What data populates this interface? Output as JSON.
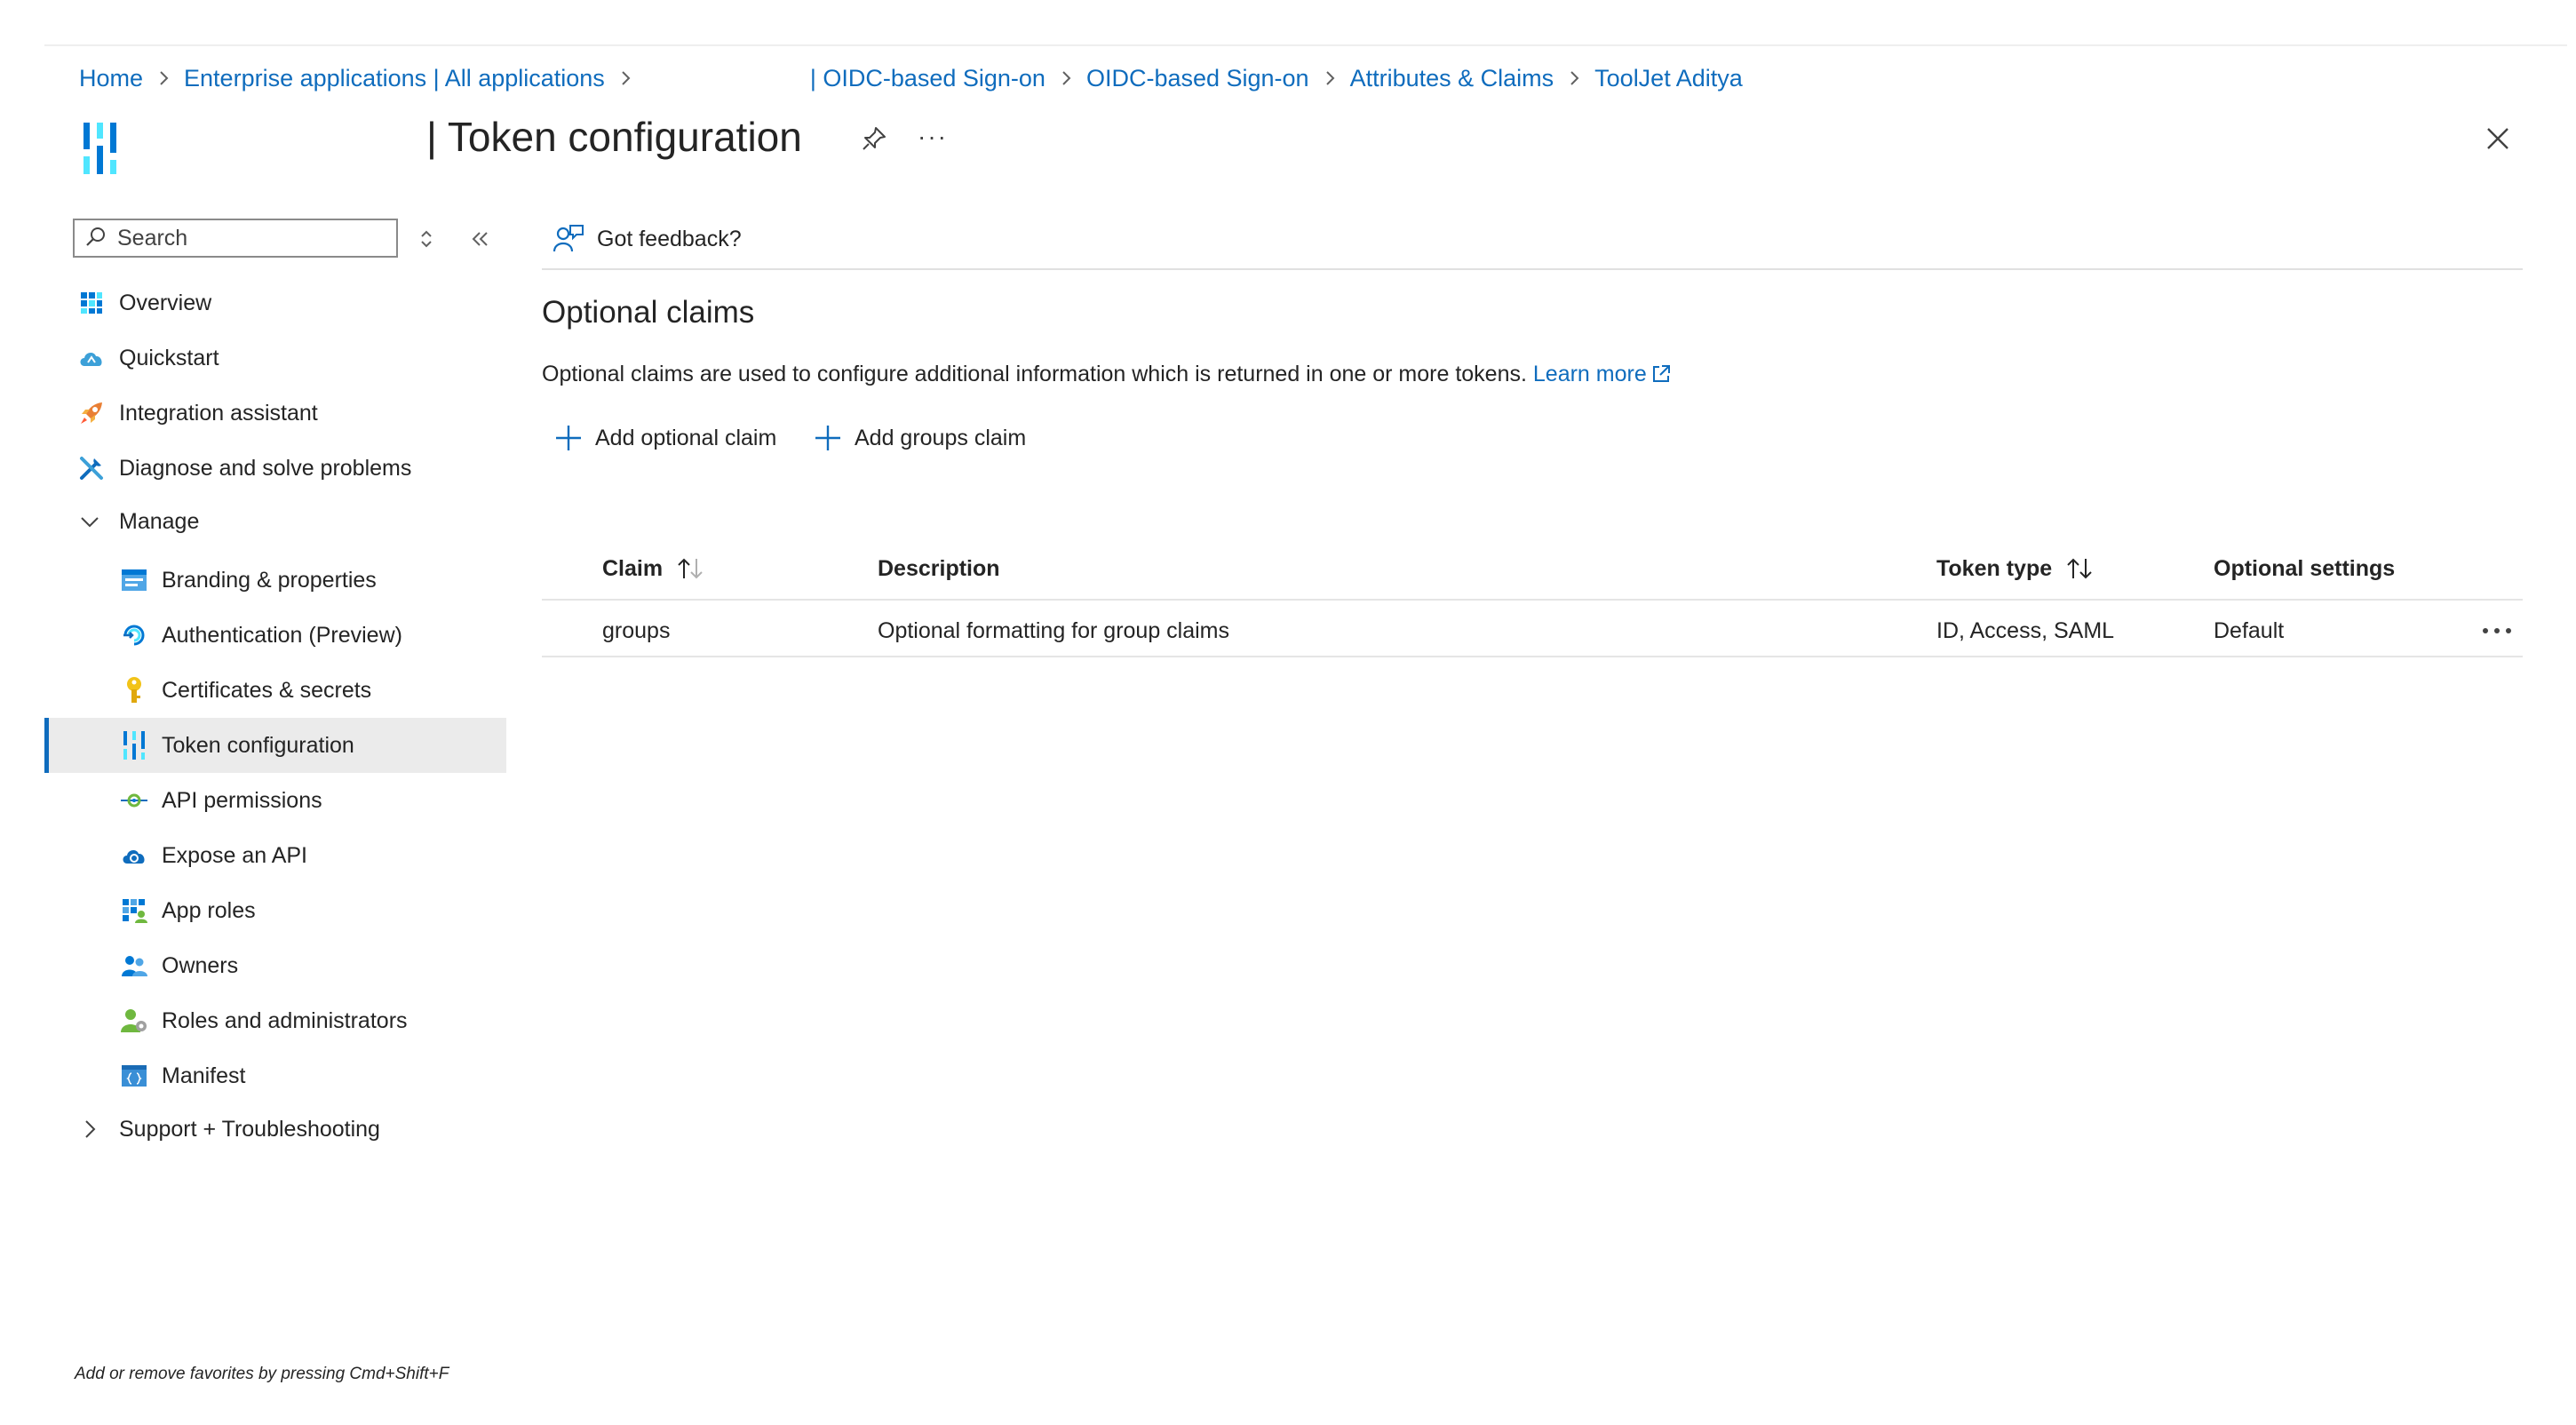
{
  "breadcrumb": {
    "items": [
      "Home",
      "Enterprise applications | All applications",
      "| OIDC-based Sign-on",
      "OIDC-based Sign-on",
      "Attributes & Claims",
      "ToolJet Aditya"
    ]
  },
  "header": {
    "title": "| Token configuration",
    "more_label": "···"
  },
  "sidebar": {
    "search_placeholder": "Search",
    "items": [
      {
        "label": "Overview",
        "icon": "overview-grid-icon"
      },
      {
        "label": "Quickstart",
        "icon": "cloud-icon"
      },
      {
        "label": "Integration assistant",
        "icon": "rocket-icon"
      },
      {
        "label": "Diagnose and solve problems",
        "icon": "wrench-icon"
      }
    ],
    "manage": {
      "label": "Manage",
      "items": [
        {
          "label": "Branding & properties",
          "icon": "branding-icon"
        },
        {
          "label": "Authentication (Preview)",
          "icon": "authentication-icon"
        },
        {
          "label": "Certificates & secrets",
          "icon": "key-icon"
        },
        {
          "label": "Token configuration",
          "icon": "token-bars-icon",
          "active": true
        },
        {
          "label": "API permissions",
          "icon": "api-permissions-icon"
        },
        {
          "label": "Expose an API",
          "icon": "cloud-api-icon"
        },
        {
          "label": "App roles",
          "icon": "app-roles-icon"
        },
        {
          "label": "Owners",
          "icon": "owners-icon"
        },
        {
          "label": "Roles and administrators",
          "icon": "roles-admin-icon"
        },
        {
          "label": "Manifest",
          "icon": "manifest-icon"
        }
      ]
    },
    "support": {
      "label": "Support + Troubleshooting"
    },
    "favorites_hint": "Add or remove favorites by pressing Cmd+Shift+F"
  },
  "main": {
    "feedback_label": "Got feedback?",
    "section_title": "Optional claims",
    "description": "Optional claims are used to configure additional information which is returned in one or more tokens.",
    "learn_more": "Learn more",
    "commands": {
      "add_optional_claim": "Add optional claim",
      "add_groups_claim": "Add groups claim"
    },
    "table": {
      "columns": [
        "Claim",
        "Description",
        "Token type",
        "Optional settings"
      ],
      "rows": [
        {
          "claim": "groups",
          "description": "Optional formatting for group claims",
          "token_type": "ID, Access, SAML",
          "optional_settings": "Default"
        }
      ]
    }
  },
  "colors": {
    "accent": "#0f6cbd",
    "active_bg": "#ebebeb",
    "text": "#242424"
  }
}
